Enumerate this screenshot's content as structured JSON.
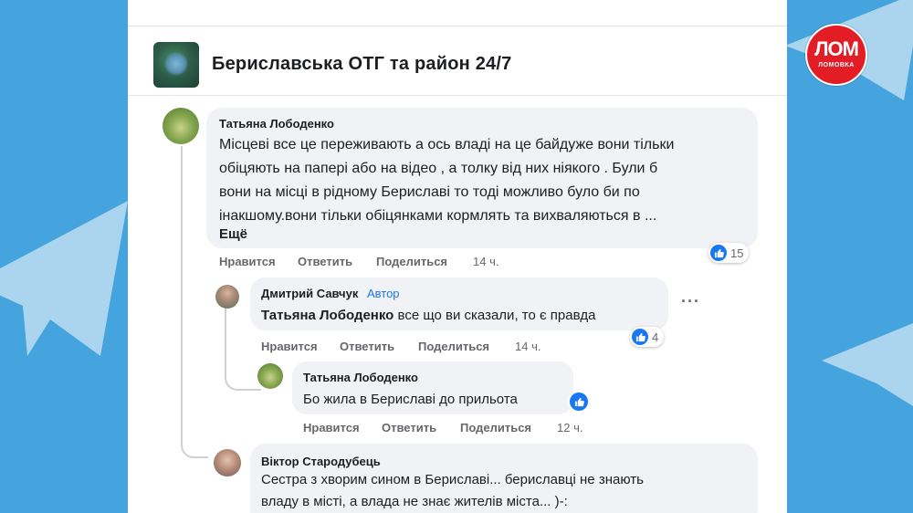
{
  "group": {
    "name": "Бериславська ОТГ та район 24/7"
  },
  "logo": {
    "main": "ЛОМ",
    "sub": "ЛОМОВКА"
  },
  "comments": [
    {
      "author": "Татьяна Лободенко",
      "lines": [
        "Місцеві все це переживають а ось владі на це байдуже вони тільки",
        "обіцяють на папері або на відео , а толку від них ніякого . Були б",
        "вони на місці в рідному Бериславі то тоді можливо було би по",
        "інакшому.вони тільки обіцянками кормлять та вихваляються в ..."
      ],
      "more": "Ещё",
      "actions": {
        "like": "Нравится",
        "reply": "Ответить",
        "share": "Поделиться",
        "time": "14 ч."
      },
      "reactions": "15"
    },
    {
      "author": "Дмитрий Савчук",
      "badge": "Автор",
      "mention": "Татьяна Лободенко",
      "text": "все що ви сказали, то є правда",
      "actions": {
        "like": "Нравится",
        "reply": "Ответить",
        "share": "Поделиться",
        "time": "14 ч."
      },
      "reactions": "4",
      "menu": "···"
    },
    {
      "author": "Татьяна Лободенко",
      "text": "Бо жила в Бериславі до прильота",
      "actions": {
        "like": "Нравится",
        "reply": "Ответить",
        "share": "Поделиться",
        "time": "12 ч."
      }
    },
    {
      "author": "Віктор Стародубець",
      "lines": [
        "Сестра з хворим сином в Бериславі... бериславці не знають",
        "владу в місті, а влада не знає жителів міста... )-:"
      ]
    }
  ],
  "icons": {
    "like": "like-icon",
    "telegram": "telegram-plane-icon",
    "menu": "more-options-icon"
  },
  "colors": {
    "background": "#45a3dd",
    "like_blue": "#1877f2",
    "logo_red": "#e21d25"
  }
}
